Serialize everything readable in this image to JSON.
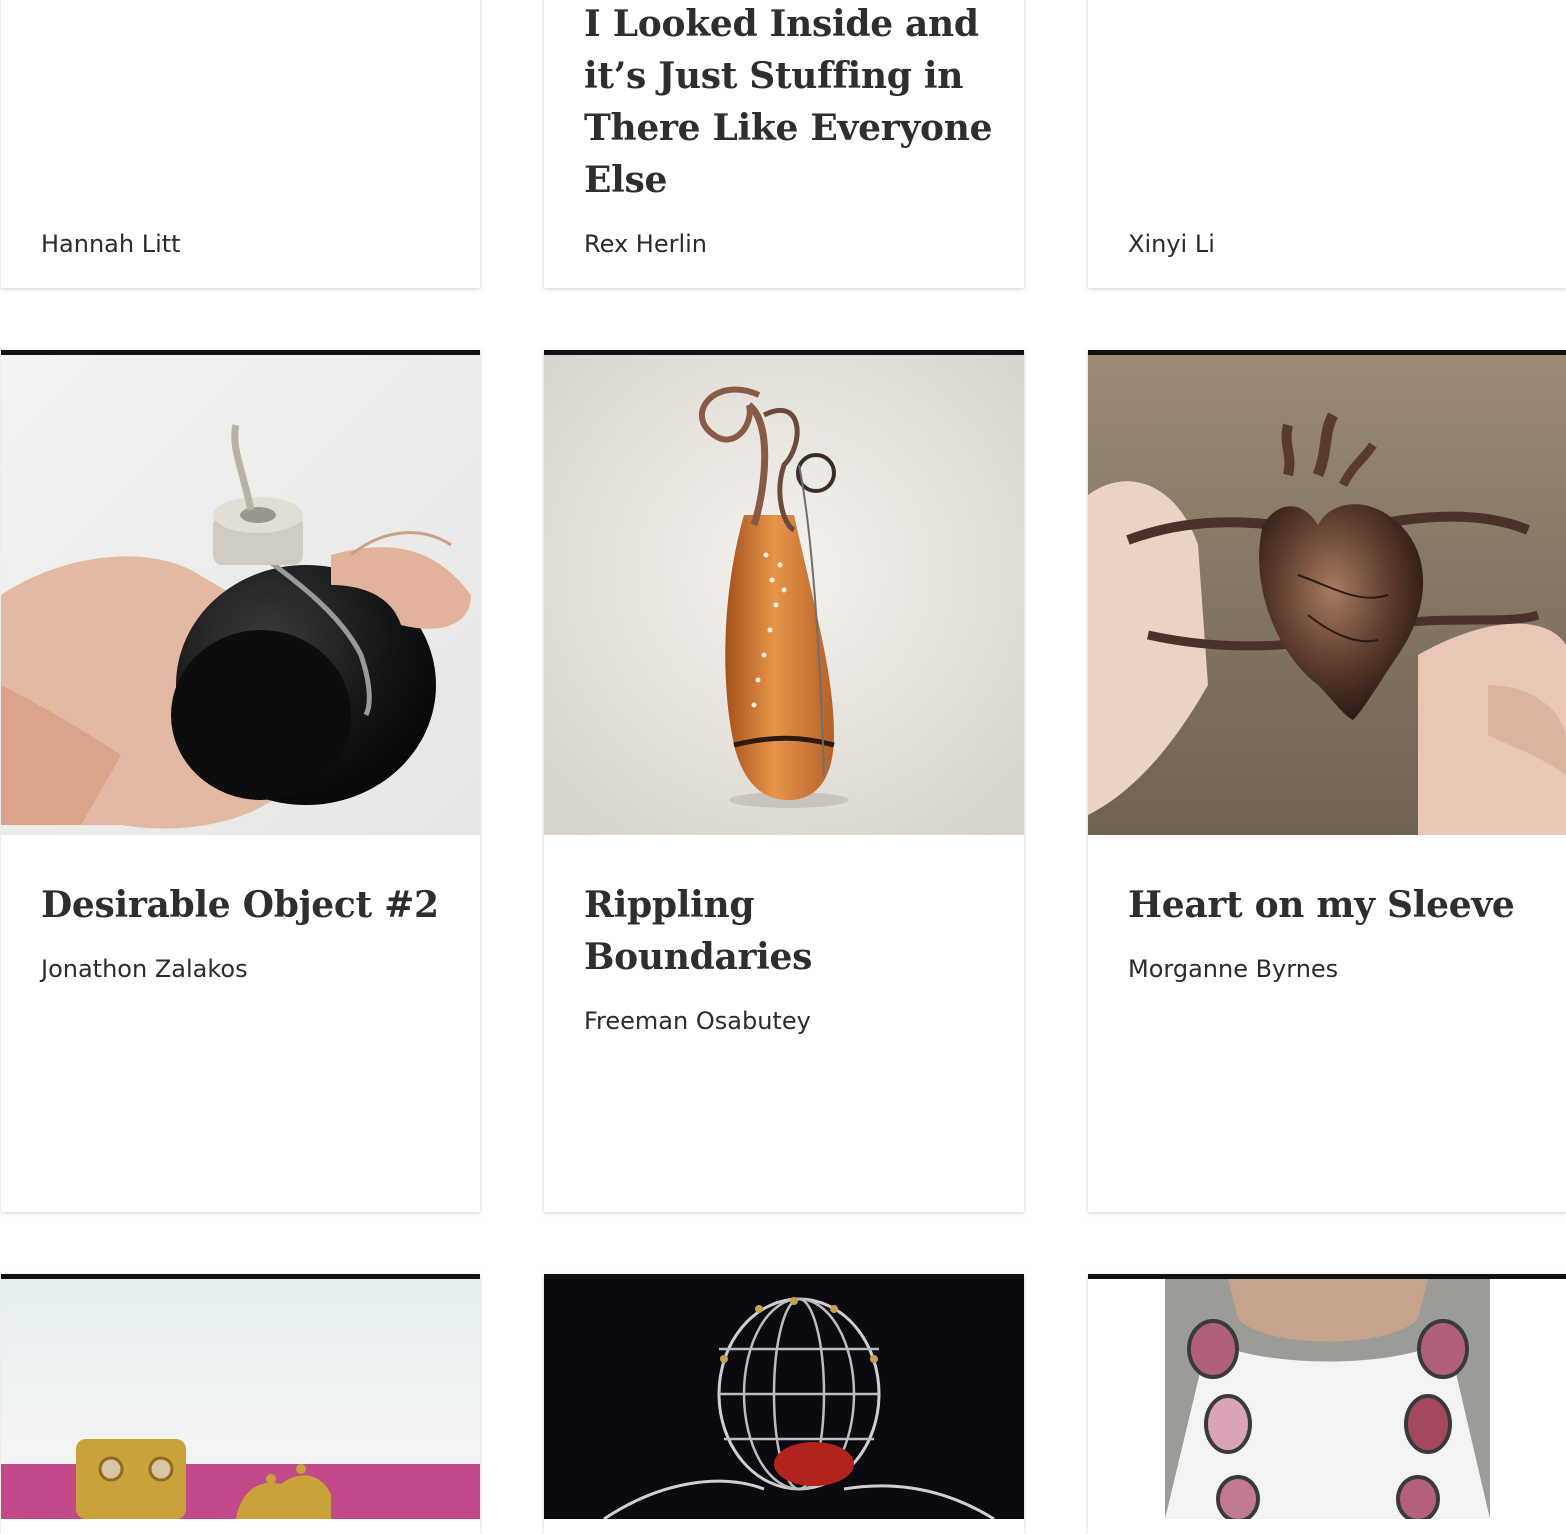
{
  "cards": [
    {
      "title": "",
      "artist": "Hannah Litt"
    },
    {
      "title": "Made With Love but I Looked Inside and it’s Just Stuffing in There Like Everyone Else",
      "artist": "Rex Herlin"
    },
    {
      "title": "",
      "artist": "Xinyi Li"
    },
    {
      "title": "Desirable Object #2",
      "artist": "Jonathon Zalakos",
      "image": "hand holding black ceramic vessel with silver cap"
    },
    {
      "title": "Rippling Boundaries",
      "artist": "Freeman Osabutey",
      "image": "wooden gourd-shaped sculpture with copper wire loops"
    },
    {
      "title": "Heart on my Sleeve",
      "artist": "Morganne Byrnes",
      "image": "bronze anatomical heart bracelet held in hand"
    },
    {
      "title": "",
      "artist": "",
      "image": "gold jewelry pieces on pink background"
    },
    {
      "title": "",
      "artist": "",
      "image": "wire cage sphere with red object on black background"
    },
    {
      "title": "",
      "artist": "",
      "image": "person wearing pink enamel oval necklace"
    }
  ],
  "colors": {
    "card_top_border": "#111111",
    "text": "#2b2b2b"
  }
}
